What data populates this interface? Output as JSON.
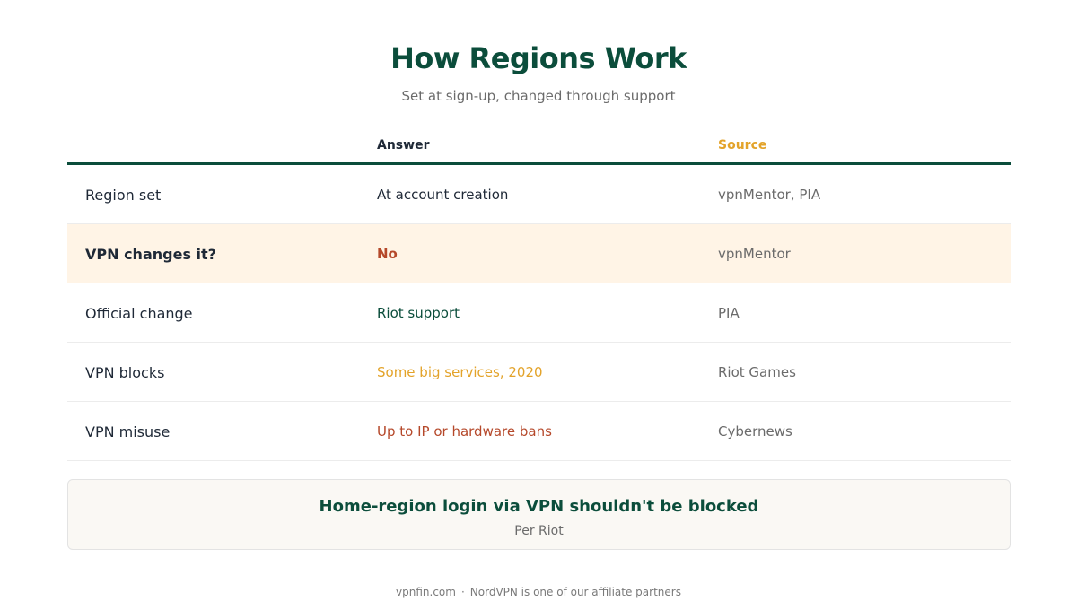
{
  "header": {
    "title": "How Regions Work",
    "subtitle": "Set at sign-up, changed through support"
  },
  "table": {
    "columns": [
      "",
      "Answer",
      "Source"
    ],
    "rows": [
      {
        "label": "Region set",
        "answer": "At account creation",
        "source": "vpnMentor, PIA",
        "answer_color": "#1f2937"
      },
      {
        "label": "VPN changes it?",
        "answer": "No",
        "source": "vpnMentor",
        "answer_color": "#b5482a",
        "highlight": true
      },
      {
        "label": "Official change",
        "answer": "Riot support",
        "source": "PIA",
        "answer_color": "#0b4d3b"
      },
      {
        "label": "VPN blocks",
        "answer": "Some big services, 2020",
        "source": "Riot Games",
        "answer_color": "#e3a32a"
      },
      {
        "label": "VPN misuse",
        "answer": "Up to IP or hardware bans",
        "source": "Cybernews",
        "answer_color": "#b5482a"
      }
    ]
  },
  "note": {
    "title": "Home-region login via VPN shouldn't be blocked",
    "subtitle": "Per Riot"
  },
  "footer": {
    "site": "vpnfin.com",
    "separator": "·",
    "disclosure": "NordVPN is one of our affiliate partners"
  },
  "colors": {
    "brand_green": "#0b4d3b",
    "accent_orange": "#e3a32a",
    "accent_red": "#b5482a",
    "highlight_bg": "#fff4e6"
  }
}
